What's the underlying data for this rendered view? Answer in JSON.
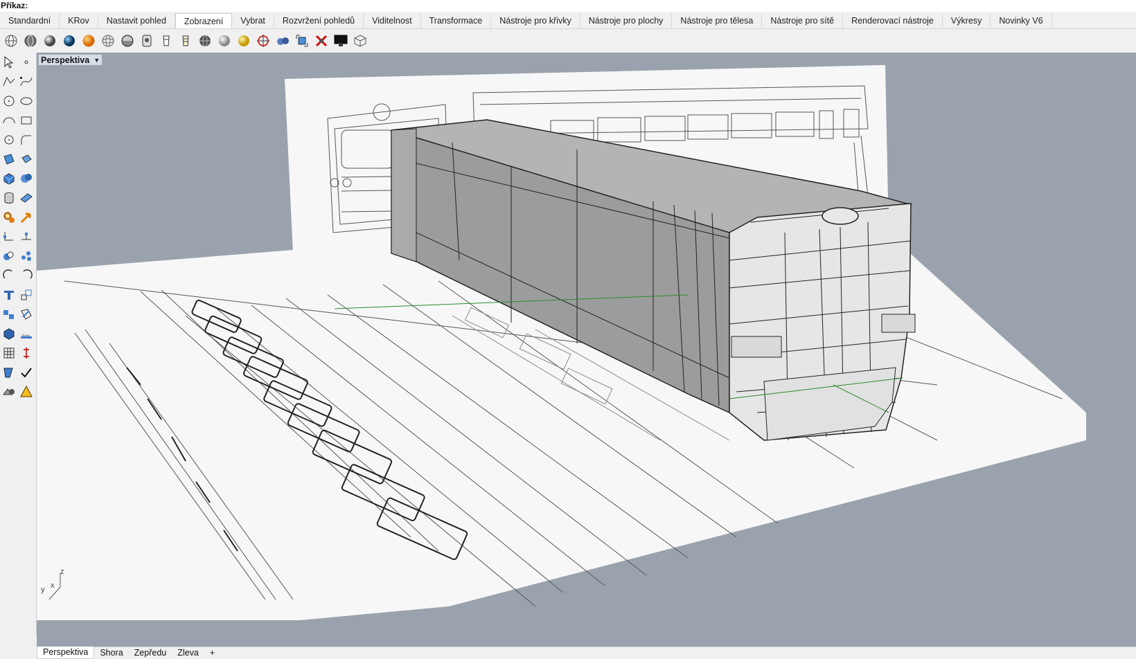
{
  "command": {
    "label": "Příkaz:"
  },
  "tabs": [
    {
      "label": "Standardní"
    },
    {
      "label": "KRov"
    },
    {
      "label": "Nastavit pohled"
    },
    {
      "label": "Zobrazení"
    },
    {
      "label": "Vybrat"
    },
    {
      "label": "Rozvržení pohledů"
    },
    {
      "label": "Viditelnost"
    },
    {
      "label": "Transformace"
    },
    {
      "label": "Nástroje pro křivky"
    },
    {
      "label": "Nástroje pro plochy"
    },
    {
      "label": "Nástroje pro tělesa"
    },
    {
      "label": "Nástroje pro sítě"
    },
    {
      "label": "Renderovací nástroje"
    },
    {
      "label": "Výkresy"
    },
    {
      "label": "Novinky V6"
    }
  ],
  "active_tab": "Zobrazení",
  "toolbar_icons": [
    "wireframe-icon",
    "shaded-icon",
    "rendered-icon",
    "ghosted-icon",
    "xray-icon",
    "wireframe-alt-icon",
    "technical-icon",
    "artistic-icon",
    "pen-icon",
    "arctic-icon",
    "globe-icon",
    "sphere-icon",
    "gold-sphere-icon",
    "target-icon",
    "camera-icon",
    "zoom-selected-icon",
    "delete-view-icon",
    "monitor-icon",
    "cube-icon"
  ],
  "viewport": {
    "label": "Perspektiva",
    "axes": {
      "z": "z",
      "y": "y",
      "x": "x"
    }
  },
  "bottom_tabs": [
    {
      "label": "Perspektiva"
    },
    {
      "label": "Shora"
    },
    {
      "label": "Zepředu"
    },
    {
      "label": "Zleva"
    },
    {
      "label": "+"
    }
  ],
  "colors": {
    "viewport_bg": "#9aa3ad",
    "model_grey": "#9b9b9b",
    "paper": "#f7f7f7"
  }
}
